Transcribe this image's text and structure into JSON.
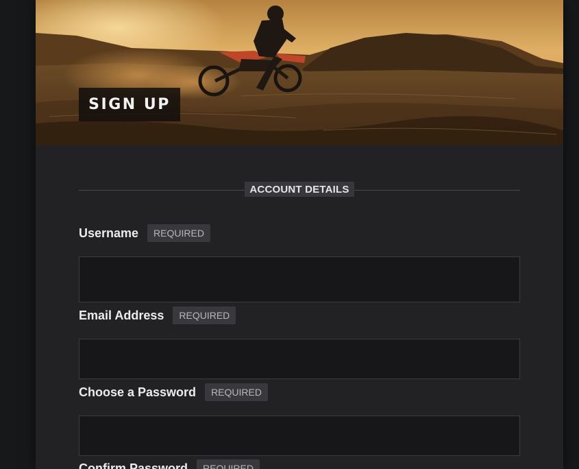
{
  "hero": {
    "title": "SIGN UP"
  },
  "section": {
    "title": "ACCOUNT DETAILS"
  },
  "fields": [
    {
      "label": "Username",
      "badge": "REQUIRED",
      "value": ""
    },
    {
      "label": "Email Address",
      "badge": "REQUIRED",
      "value": ""
    },
    {
      "label": "Choose a Password",
      "badge": "REQUIRED",
      "value": ""
    },
    {
      "label": "Confirm Password",
      "badge": "REQUIRED",
      "value": ""
    }
  ],
  "colors": {
    "page_background": "#17181a",
    "card_background": "#222224",
    "input_background": "#171719",
    "badge_background": "#39393d",
    "hero_sky": "#d9a65a"
  },
  "icons": {
    "hero_image": "dirt-bike-rider-photo"
  }
}
